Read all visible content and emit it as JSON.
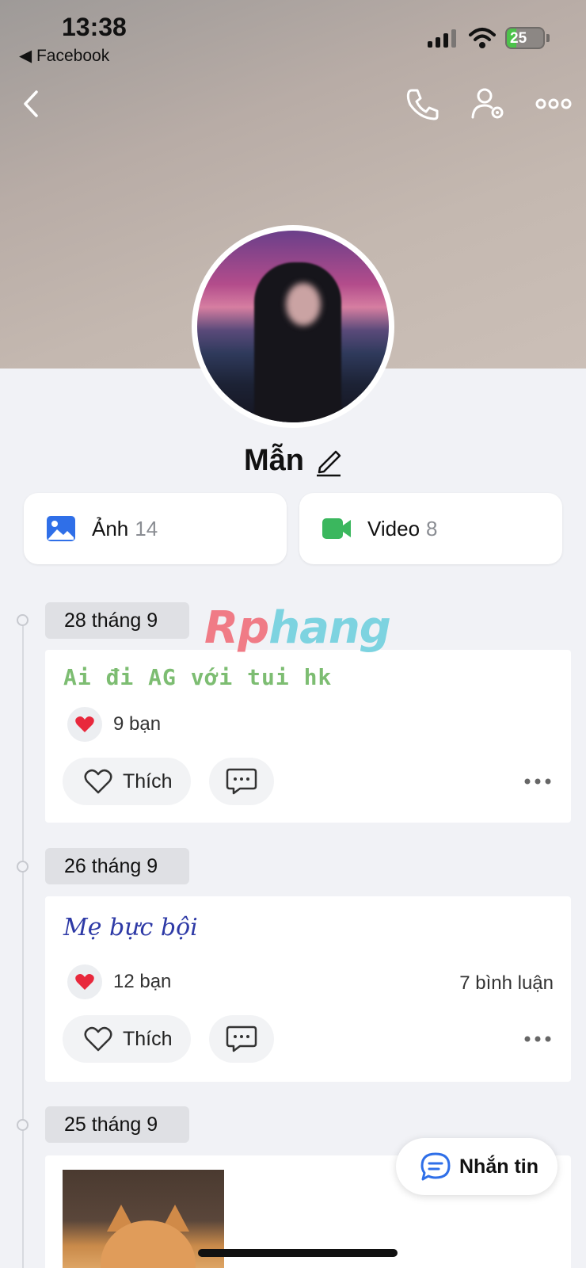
{
  "status_bar": {
    "time": "13:38",
    "back_app": "◀ Facebook",
    "battery": "25",
    "battery_level": 0.25
  },
  "header": {
    "back_icon": "chevron-left-icon",
    "call_icon": "phone-icon",
    "settings_icon": "user-settings-icon",
    "more_icon": "more-horizontal-icon"
  },
  "profile": {
    "name": "Mẫn"
  },
  "media": {
    "photo": {
      "label": "Ảnh",
      "count": "14"
    },
    "video": {
      "label": "Video",
      "count": "8"
    }
  },
  "watermark": {
    "part1": "Rp",
    "part2": "hang"
  },
  "timeline": [
    {
      "date": "28 tháng 9",
      "text": "Ai đi AG với tui hk",
      "reactions": "9 bạn",
      "comments": "",
      "like_label": "Thích"
    },
    {
      "date": "26 tháng 9",
      "text": "Mẹ bực bội",
      "reactions": "12 bạn",
      "comments": "7 bình luận",
      "like_label": "Thích"
    },
    {
      "date": "25 tháng 9",
      "text": "",
      "reactions": "",
      "comments": "",
      "like_label": ""
    }
  ],
  "fab": {
    "label": "Nhắn tin"
  },
  "colors": {
    "photo_icon": "#2f6fe8",
    "video_icon": "#3bb75e",
    "heart": "#e8283c",
    "fab_icon": "#2f6fe8"
  }
}
